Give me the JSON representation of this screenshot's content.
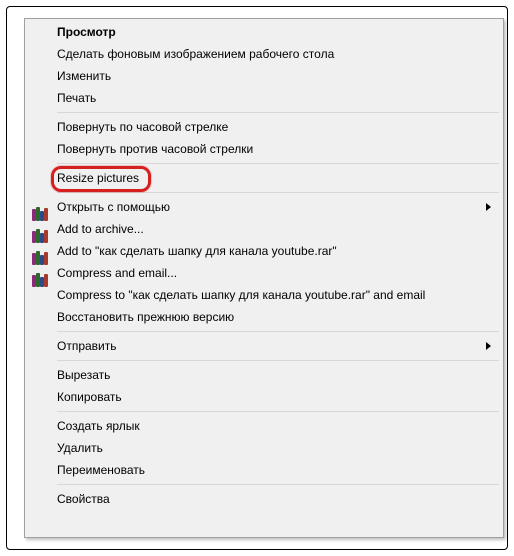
{
  "menu": {
    "preview": "Просмотр",
    "set_wallpaper": "Сделать фоновым изображением рабочего стола",
    "edit": "Изменить",
    "print": "Печать",
    "rotate_cw": "Повернуть по часовой стрелке",
    "rotate_ccw": "Повернуть против часовой стрелки",
    "resize_pictures": "Resize pictures",
    "open_with": "Открыть с помощью",
    "add_to_archive": "Add to archive...",
    "add_to_named": "Add to \"как сделать шапку для канала youtube.rar\"",
    "compress_email": "Compress and email...",
    "compress_named_email": "Compress to \"как сделать шапку для канала youtube.rar\" and email",
    "restore_version": "Восстановить прежнюю версию",
    "send_to": "Отправить",
    "cut": "Вырезать",
    "copy": "Копировать",
    "create_shortcut": "Создать ярлык",
    "delete": "Удалить",
    "rename": "Переименовать",
    "properties": "Свойства"
  }
}
